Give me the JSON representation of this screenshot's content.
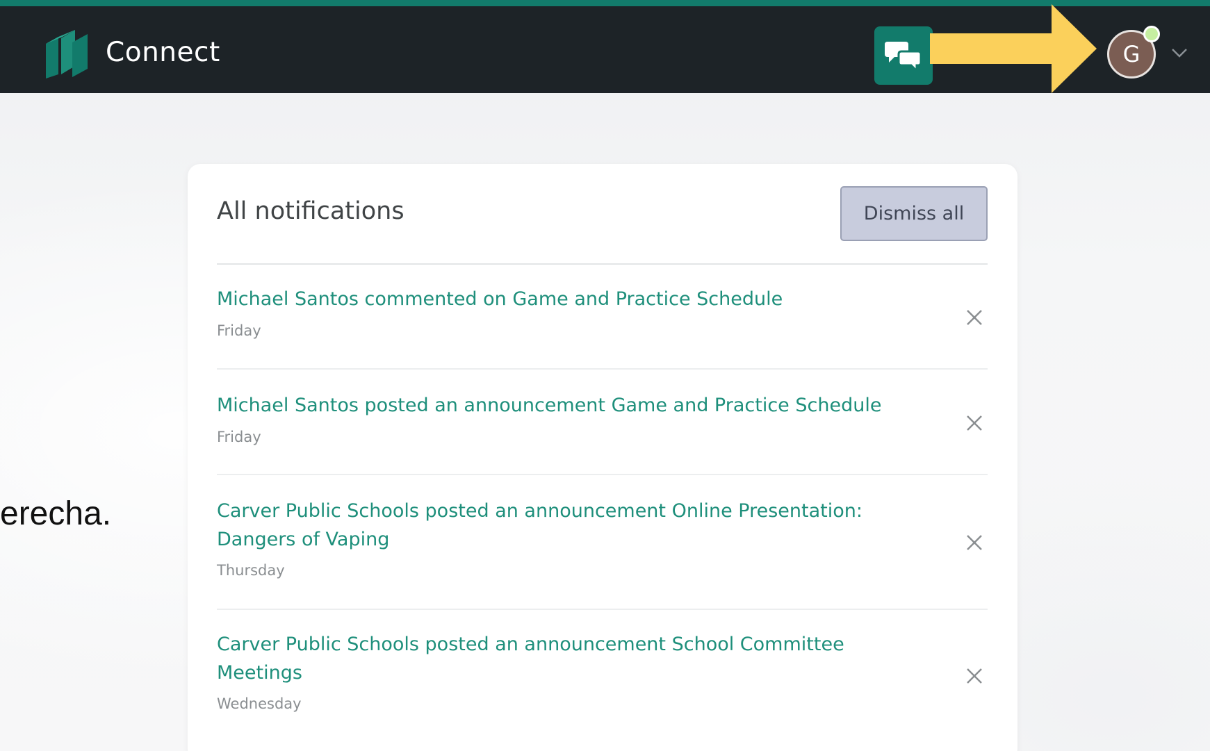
{
  "header": {
    "app_title": "Connect",
    "avatar_initial": "G",
    "colors": {
      "bar": "#1d2327",
      "accent": "#127b6b",
      "arrow": "#fbd05b",
      "status_dot": "#c6efa1"
    }
  },
  "icons": {
    "logo": "books-logo-icon",
    "chat": "chat-bubbles-icon",
    "arrow": "arrow-right-icon",
    "chevron": "chevron-down-icon",
    "close": "close-icon"
  },
  "side_fragment": "erecha.",
  "notifications": {
    "title": "All notifications",
    "dismiss_all_label": "Dismiss all",
    "items": [
      {
        "text": "Michael Santos commented on Game and Practice Schedule",
        "day": "Friday"
      },
      {
        "text": "Michael Santos posted an announcement Game and Practice Schedule",
        "day": "Friday"
      },
      {
        "text": "Carver Public Schools posted an announcement Online Presentation: Dangers of Vaping",
        "day": "Thursday"
      },
      {
        "text": "Carver Public Schools posted an announcement School Committee Meetings",
        "day": "Wednesday"
      }
    ]
  }
}
